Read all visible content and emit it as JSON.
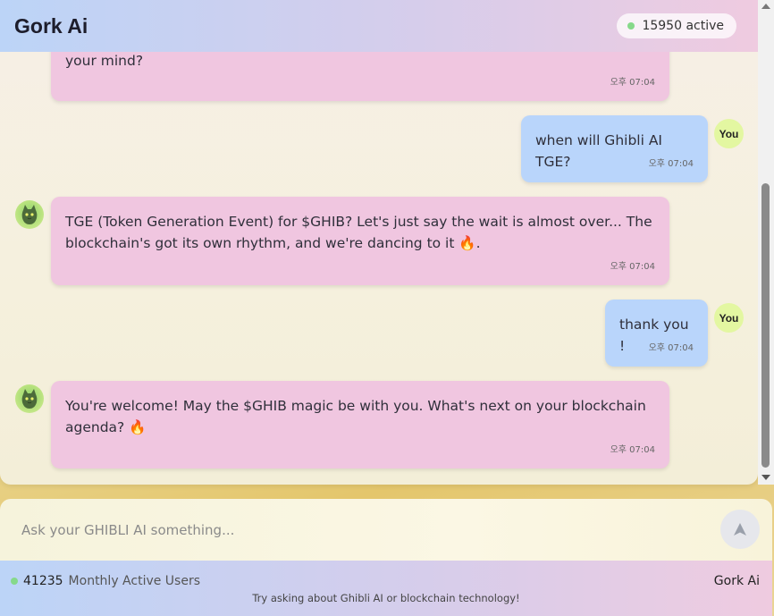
{
  "header": {
    "title": "Gork Ai",
    "active_count": "15950",
    "active_label": "active"
  },
  "messages": [
    {
      "role": "ai",
      "text": "your mind?",
      "time": "오후 07:04"
    },
    {
      "role": "user",
      "badge": "You",
      "text": "when will Ghibli AI TGE?",
      "time": "오후 07:04"
    },
    {
      "role": "ai",
      "text_line1": "TGE (Token Generation Event) for $GHIB? Let's just say the wait is almost over... The",
      "text_line2": "blockchain's got its own rhythm, and we're dancing to it 🔥.",
      "time": "오후 07:04"
    },
    {
      "role": "user",
      "badge": "You",
      "text": "thank you !",
      "time": "오후 07:04"
    },
    {
      "role": "ai",
      "text_line1": "You're welcome! May the $GHIB magic be with you. What's next on your blockchain",
      "text_line2": "agenda? 🔥",
      "time": "오후 07:04"
    }
  ],
  "input": {
    "placeholder": "Ask your GHIBLI AI something..."
  },
  "footer": {
    "users_count": "41235",
    "users_label": "Monthly Active Users",
    "brand": "Gork Ai",
    "hint": "Try asking about Ghibli AI or blockchain technology!"
  },
  "icons": {
    "send": "send-arrow-icon",
    "avatar": "cat-avatar-icon",
    "status": "status-dot-icon"
  },
  "colors": {
    "ai_bubble": "#f0c6e0",
    "user_bubble": "#b9d5fb",
    "you_badge": "#e3f7a1",
    "status_dot": "#86d98a"
  }
}
